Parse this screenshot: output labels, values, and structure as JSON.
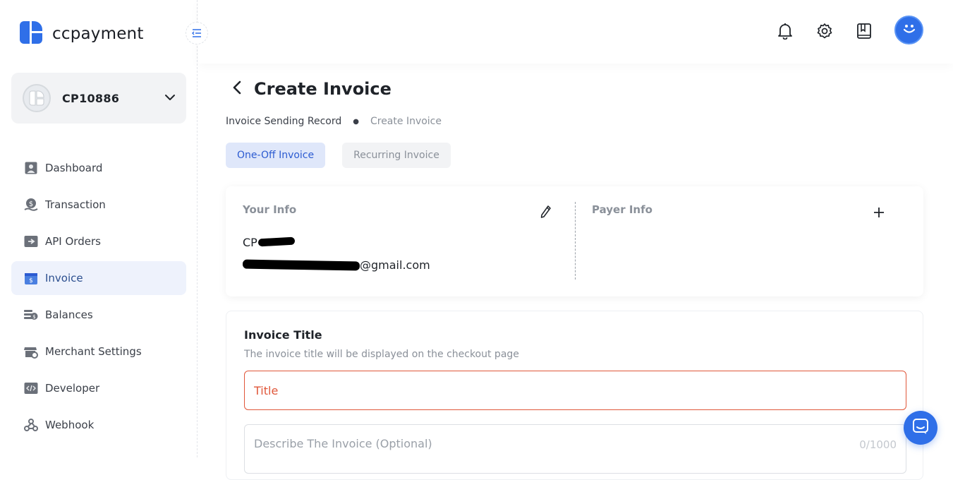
{
  "brand": {
    "name": "ccpayment",
    "accent": "#2f6fe8"
  },
  "account": {
    "id": "CP10886"
  },
  "sidebar": {
    "items": [
      {
        "label": "Dashboard",
        "icon": "dashboard-icon"
      },
      {
        "label": "Transaction",
        "icon": "transaction-icon"
      },
      {
        "label": "API Orders",
        "icon": "api-orders-icon"
      },
      {
        "label": "Invoice",
        "icon": "invoice-icon",
        "active": true
      },
      {
        "label": "Balances",
        "icon": "balances-icon"
      },
      {
        "label": "Merchant Settings",
        "icon": "merchant-settings-icon"
      },
      {
        "label": "Developer",
        "icon": "developer-icon"
      },
      {
        "label": "Webhook",
        "icon": "webhook-icon"
      }
    ]
  },
  "header": {
    "icons": [
      "bell-icon",
      "gear-icon",
      "book-icon",
      "user-avatar-icon"
    ]
  },
  "page": {
    "title": "Create Invoice",
    "breadcrumb": [
      "Invoice Sending Record",
      "Create Invoice"
    ],
    "tabs": [
      {
        "label": "One-Off Invoice",
        "active": true
      },
      {
        "label": "Recurring Invoice",
        "active": false
      }
    ]
  },
  "info": {
    "your_info_label": "Your Info",
    "payer_info_label": "Payer Info",
    "your_name": "CP",
    "your_email_suffix": "@gmail.com"
  },
  "form": {
    "label": "Invoice Title",
    "hint": "The invoice title will be displayed on the checkout page",
    "title_placeholder": "Title",
    "desc_placeholder": "Describe The Invoice (Optional)",
    "desc_count": "0/1000"
  }
}
